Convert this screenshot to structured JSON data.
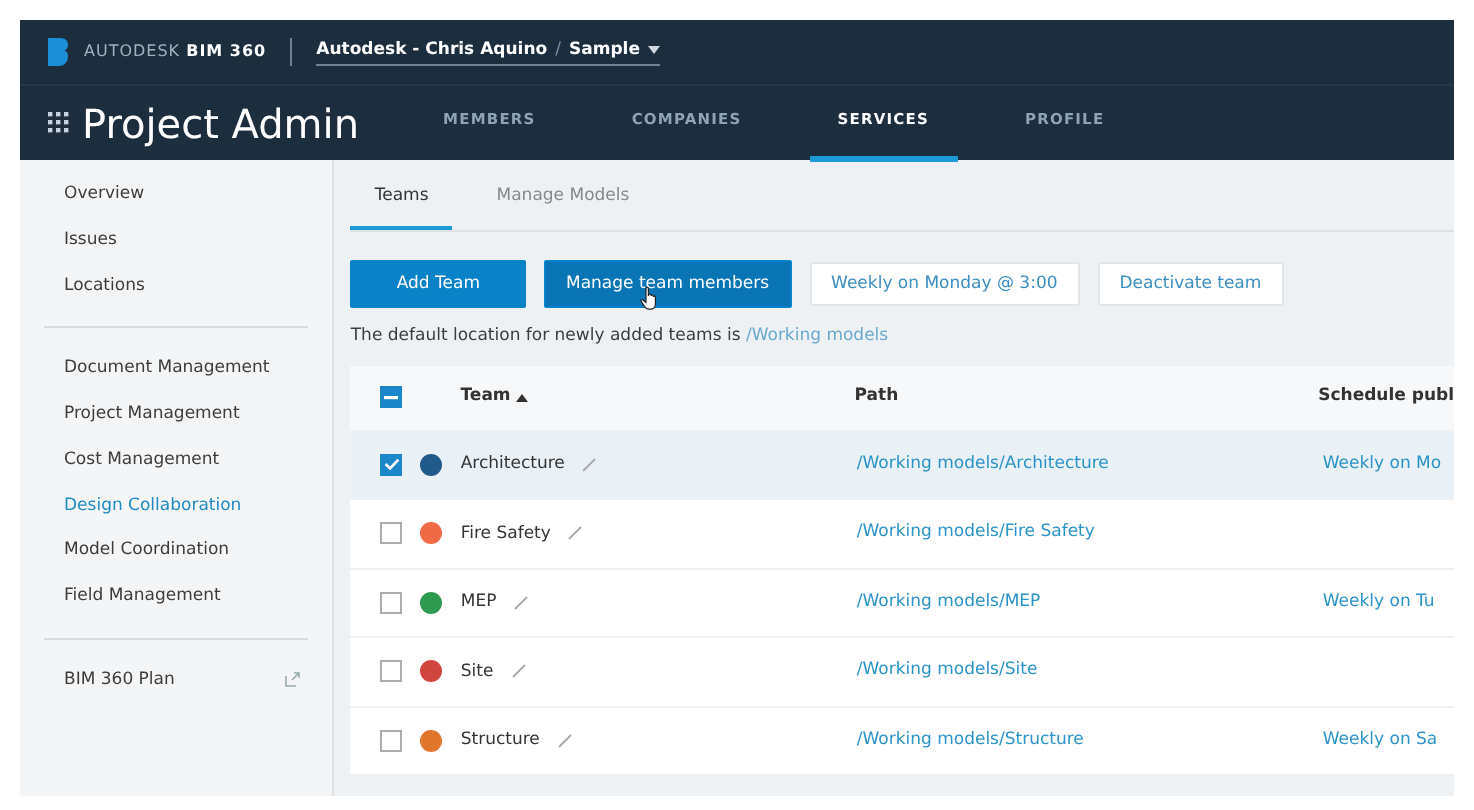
{
  "brand": {
    "company": "AUTODESK",
    "product": "BIM 360"
  },
  "breadcrumb": {
    "account": "Autodesk - Chris Aquino",
    "separator": "/",
    "project": "Sample"
  },
  "app_title": "Project Admin",
  "nav_tabs": [
    {
      "label": "MEMBERS",
      "selected": false
    },
    {
      "label": "COMPANIES",
      "selected": false
    },
    {
      "label": "SERVICES",
      "selected": true
    },
    {
      "label": "PROFILE",
      "selected": false
    }
  ],
  "sidebar": {
    "groups": [
      [
        {
          "label": "Overview",
          "selected": false
        },
        {
          "label": "Issues",
          "selected": false
        },
        {
          "label": "Locations",
          "selected": false
        }
      ],
      [
        {
          "label": "Document Management",
          "selected": false
        },
        {
          "label": "Project Management",
          "selected": false
        },
        {
          "label": "Cost Management",
          "selected": false
        },
        {
          "label": "Design Collaboration",
          "selected": true
        },
        {
          "label": "Model Coordination",
          "selected": false
        },
        {
          "label": "Field Management",
          "selected": false
        }
      ],
      [
        {
          "label": "BIM 360 Plan",
          "selected": false,
          "external": true
        }
      ]
    ]
  },
  "sub_tabs": [
    {
      "label": "Teams",
      "selected": true
    },
    {
      "label": "Manage Models",
      "selected": false
    }
  ],
  "actions": [
    {
      "label": "Add Team",
      "kind": "primary"
    },
    {
      "label": "Manage team members",
      "kind": "primary",
      "hovered": true
    },
    {
      "label": "Weekly on Monday @ 3:00",
      "kind": "secondary"
    },
    {
      "label": "Deactivate team",
      "kind": "secondary"
    }
  ],
  "default_location": {
    "text": "The default location for newly added teams is",
    "link": "/Working models"
  },
  "table": {
    "select_all_indeterminate": true,
    "columns": [
      {
        "label": "Team",
        "sorted": true
      },
      {
        "label": "Path",
        "sorted": false
      },
      {
        "label": "Schedule publ",
        "sorted": false
      }
    ],
    "rows": [
      {
        "team": "Architecture",
        "color": "#1f5a8a",
        "checked": true,
        "path": "/Working models/Architecture",
        "schedule": "Weekly on Mo"
      },
      {
        "team": "Fire Safety",
        "color": "#ef6a45",
        "checked": false,
        "path": "/Working models/Fire Safety"
      },
      {
        "team": "MEP",
        "color": "#2e9a4f",
        "checked": false,
        "path": "/Working models/MEP",
        "schedule": "Weekly on Tu"
      },
      {
        "team": "Site",
        "color": "#d0463f",
        "checked": false,
        "path": "/Working models/Site"
      },
      {
        "team": "Structure",
        "color": "#e0762c",
        "checked": false,
        "path": "/Working models/Structure",
        "schedule": "Weekly on Sa"
      }
    ]
  }
}
